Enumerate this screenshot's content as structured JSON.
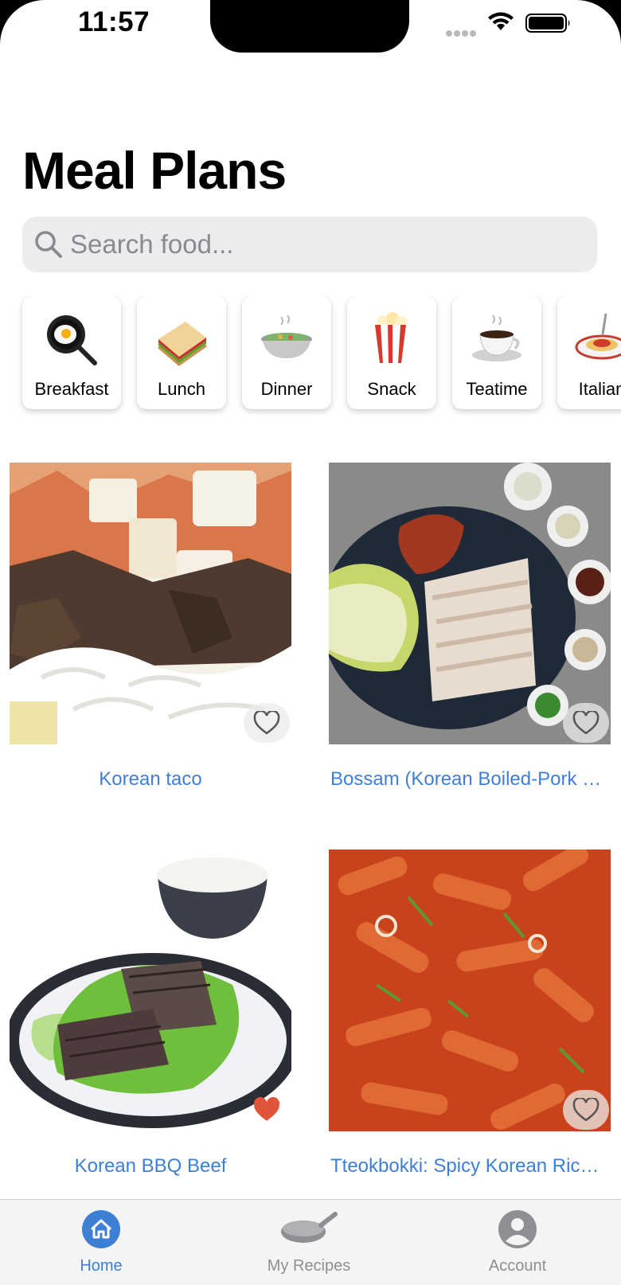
{
  "status_bar": {
    "time": "11:57"
  },
  "page_title": "Meal Plans",
  "search": {
    "placeholder": "Search food..."
  },
  "categories": [
    {
      "label": "Breakfast",
      "icon": "frying-pan-egg"
    },
    {
      "label": "Lunch",
      "icon": "sandwich"
    },
    {
      "label": "Dinner",
      "icon": "stew-pot"
    },
    {
      "label": "Snack",
      "icon": "popcorn"
    },
    {
      "label": "Teatime",
      "icon": "coffee-cup"
    },
    {
      "label": "Italian",
      "icon": "spaghetti"
    }
  ],
  "recipes": [
    {
      "title": "Korean taco",
      "favorite": false
    },
    {
      "title": "Bossam (Korean Boiled-Pork Wraps)",
      "favorite": false
    },
    {
      "title": "Korean BBQ Beef",
      "favorite": true
    },
    {
      "title": "Tteokbokki: Spicy Korean Rice Cakes",
      "favorite": false
    }
  ],
  "tab_bar": {
    "tabs": [
      {
        "label": "Home",
        "icon": "home-icon",
        "active": true
      },
      {
        "label": "My Recipes",
        "icon": "pan-icon",
        "active": false
      },
      {
        "label": "Account",
        "icon": "account-icon",
        "active": false
      }
    ]
  },
  "colors": {
    "accent": "#3e7fd6",
    "favorite": "#e0543a",
    "inactive_tab": "#8e8e93"
  }
}
